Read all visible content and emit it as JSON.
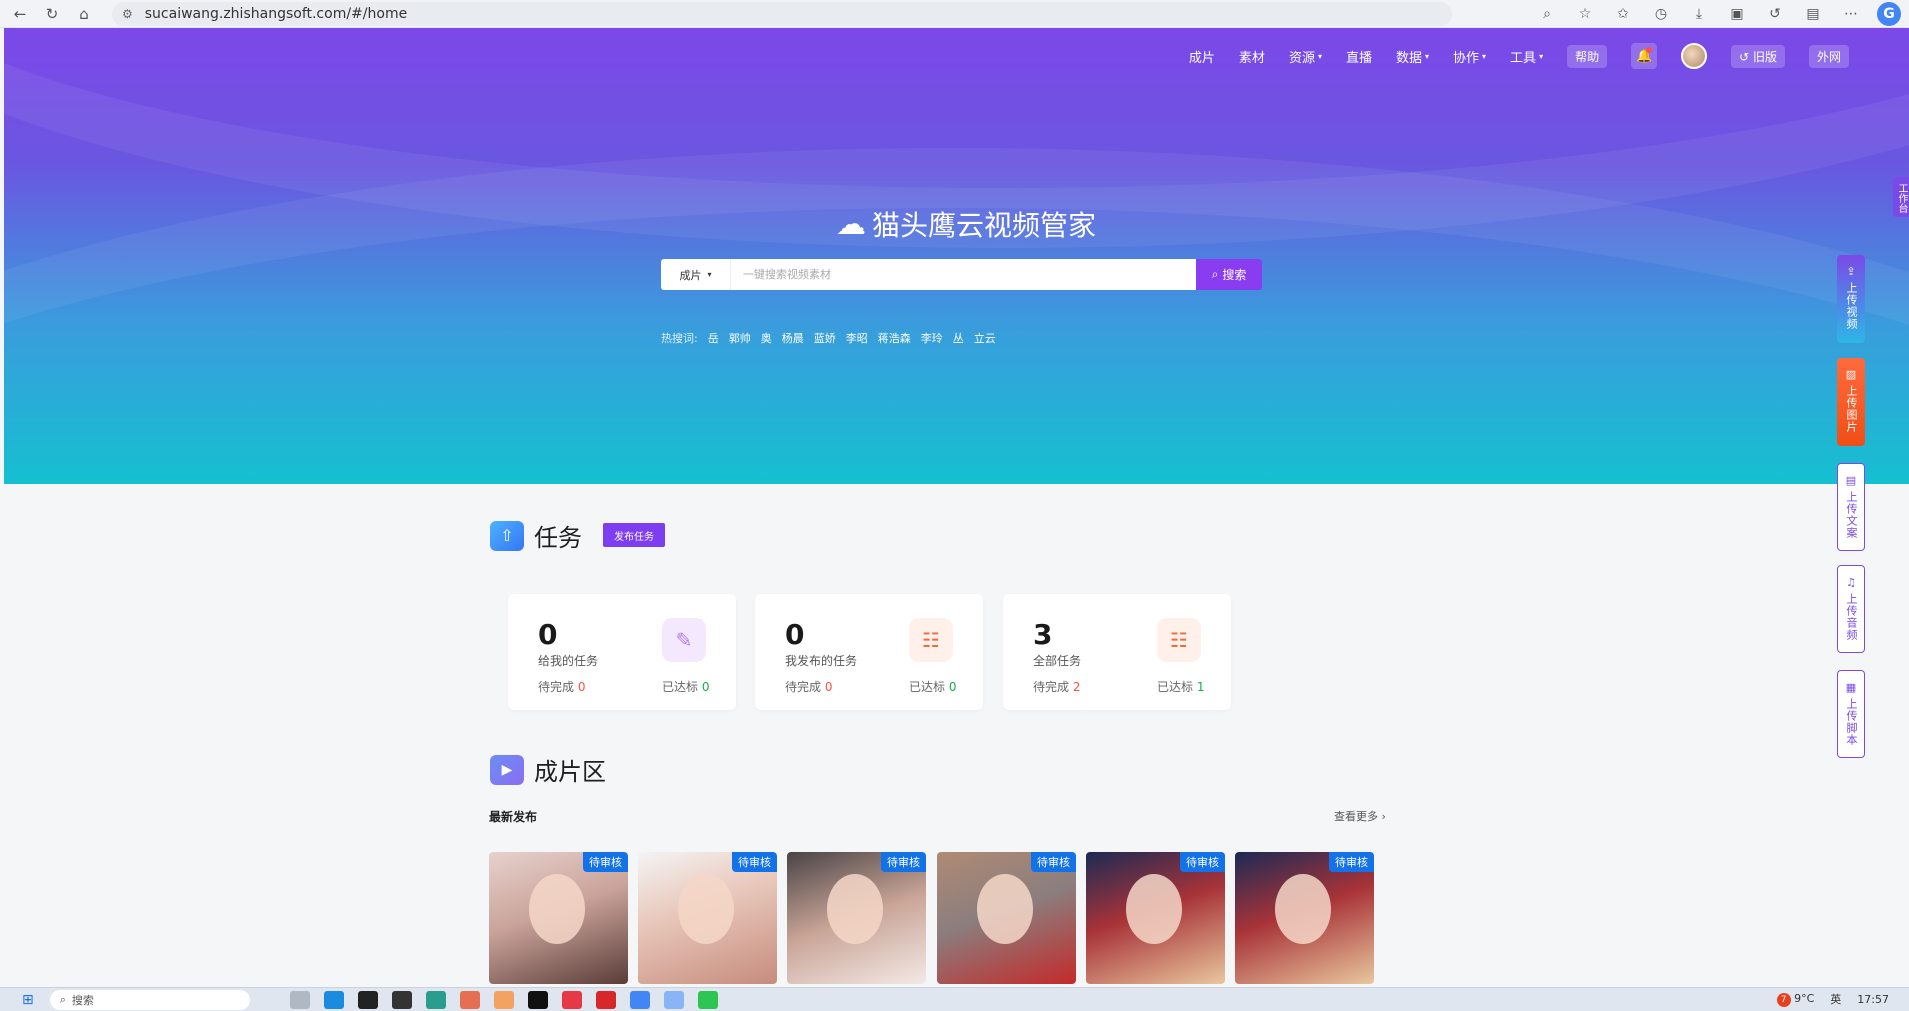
{
  "browser": {
    "url": "sucaiwang.zhishangsoft.com/#/home"
  },
  "nav": {
    "items": [
      {
        "label": "成片",
        "dropdown": false
      },
      {
        "label": "素材",
        "dropdown": false
      },
      {
        "label": "资源",
        "dropdown": true
      },
      {
        "label": "直播",
        "dropdown": false
      },
      {
        "label": "数据",
        "dropdown": true
      },
      {
        "label": "协作",
        "dropdown": true
      },
      {
        "label": "工具",
        "dropdown": true
      }
    ],
    "help": "帮助",
    "old_version": "旧版",
    "external": "外网"
  },
  "hero": {
    "title": "猫头鹰云视频管家",
    "search": {
      "category": "成片",
      "placeholder": "一键搜索视频素材",
      "button": "搜索"
    },
    "hotwords_label": "热搜词:",
    "hotwords": [
      "岳",
      "郭帅",
      "奥",
      "杨晨",
      "蓝娇",
      "李昭",
      "蒋浩森",
      "李玲",
      "丛",
      "立云"
    ]
  },
  "side_tabs": {
    "workbench": "工作台",
    "upload_video": "上传视频",
    "upload_image": "上传图片",
    "upload_doc": "上传文案",
    "upload_audio": "上传音频",
    "upload_script": "上传脚本"
  },
  "tasks": {
    "title": "任务",
    "publish_button": "发布任务",
    "cards": [
      {
        "count": "0",
        "name": "给我的任务",
        "pending_label": "待完成",
        "pending": "0",
        "done_label": "已达标",
        "done": "0"
      },
      {
        "count": "0",
        "name": "我发布的任务",
        "pending_label": "待完成",
        "pending": "0",
        "done_label": "已达标",
        "done": "0"
      },
      {
        "count": "3",
        "name": "全部任务",
        "pending_label": "待完成",
        "pending": "2",
        "done_label": "已达标",
        "done": "1"
      }
    ]
  },
  "film": {
    "title": "成片区",
    "latest": "最新发布",
    "more": "查看更多",
    "badge": "待审核"
  },
  "taskbar": {
    "search": "搜索",
    "weather": "9°C",
    "weather_badge": "7",
    "lang": "英",
    "time": "17:57"
  },
  "colors": {
    "accent": "#7c3ef0",
    "hero_top": "#7c48e8",
    "hero_bottom": "#15c0d0",
    "badge_blue": "#1472e8",
    "pending_red": "#f5533d",
    "done_green": "#1dab4c"
  }
}
